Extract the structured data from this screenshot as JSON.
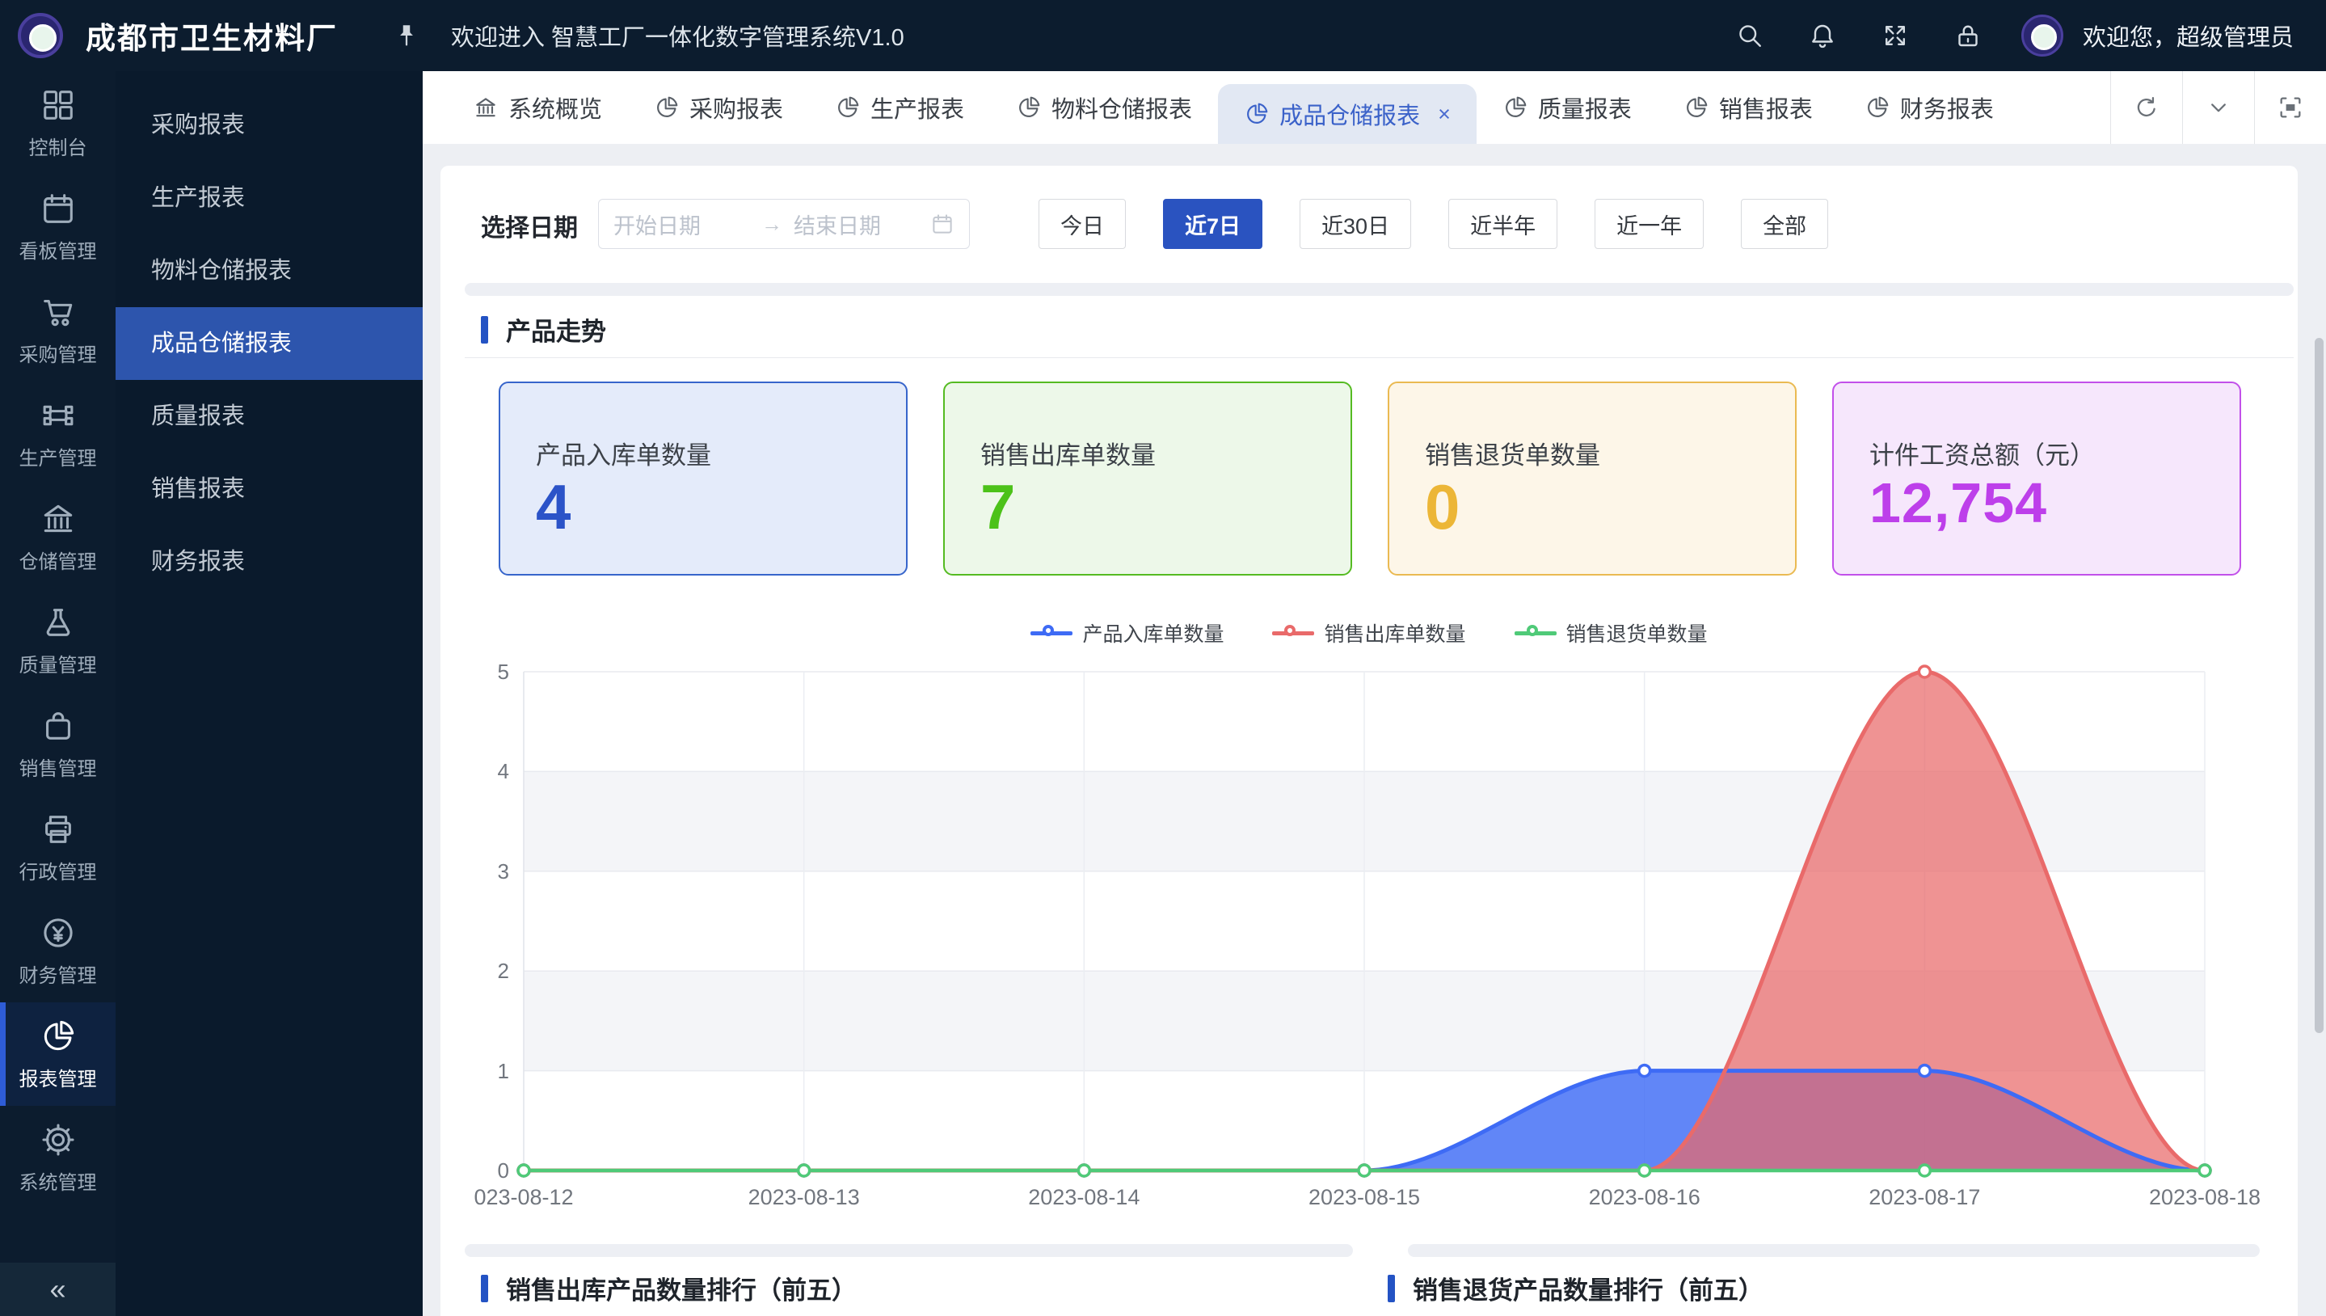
{
  "header": {
    "brand": "成都市卫生材料厂",
    "welcome": "欢迎进入 智慧工厂一体化数字管理系统V1.0",
    "greeting": "欢迎您，超级管理员",
    "icons": [
      "pin-icon",
      "search-icon",
      "bell-icon",
      "fullscreen-expand-icon",
      "lock-icon"
    ]
  },
  "rail": {
    "items": [
      {
        "label": "控制台",
        "icon": "dashboard-grid-icon",
        "active": false
      },
      {
        "label": "看板管理",
        "icon": "board-calendar-icon",
        "active": false
      },
      {
        "label": "采购管理",
        "icon": "cart-icon",
        "active": false
      },
      {
        "label": "生产管理",
        "icon": "production-nodes-icon",
        "active": false
      },
      {
        "label": "仓储管理",
        "icon": "warehouse-bank-icon",
        "active": false
      },
      {
        "label": "质量管理",
        "icon": "quality-flask-icon",
        "active": false
      },
      {
        "label": "销售管理",
        "icon": "sales-bag-icon",
        "active": false
      },
      {
        "label": "行政管理",
        "icon": "admin-printer-icon",
        "active": false
      },
      {
        "label": "财务管理",
        "icon": "finance-exchange-icon",
        "active": false
      },
      {
        "label": "报表管理",
        "icon": "report-pie-icon",
        "active": true
      },
      {
        "label": "系统管理",
        "icon": "system-gear-icon",
        "active": false
      }
    ],
    "collapse_glyph": "«"
  },
  "submenu": {
    "items": [
      {
        "label": "采购报表",
        "active": false
      },
      {
        "label": "生产报表",
        "active": false
      },
      {
        "label": "物料仓储报表",
        "active": false
      },
      {
        "label": "成品仓储报表",
        "active": true
      },
      {
        "label": "质量报表",
        "active": false
      },
      {
        "label": "销售报表",
        "active": false
      },
      {
        "label": "财务报表",
        "active": false
      }
    ]
  },
  "tabs": {
    "items": [
      {
        "label": "系统概览",
        "icon": "bank-icon",
        "active": false,
        "closable": false
      },
      {
        "label": "采购报表",
        "icon": "pie-icon",
        "active": false,
        "closable": false
      },
      {
        "label": "生产报表",
        "icon": "pie-icon",
        "active": false,
        "closable": false
      },
      {
        "label": "物料仓储报表",
        "icon": "pie-icon",
        "active": false,
        "closable": false
      },
      {
        "label": "成品仓储报表",
        "icon": "pie-icon",
        "active": true,
        "closable": true
      },
      {
        "label": "质量报表",
        "icon": "pie-icon",
        "active": false,
        "closable": false
      },
      {
        "label": "销售报表",
        "icon": "pie-icon",
        "active": false,
        "closable": false
      },
      {
        "label": "财务报表",
        "icon": "pie-icon",
        "active": false,
        "closable": false
      }
    ],
    "close_glyph": "×",
    "tools": [
      "refresh-icon",
      "chevron-down-icon",
      "maximize-icon"
    ]
  },
  "filters": {
    "label": "选择日期",
    "start_placeholder": "开始日期",
    "separator": "→",
    "end_placeholder": "结束日期",
    "calendar_icon": "calendar-icon",
    "ranges": [
      {
        "label": "今日",
        "active": false
      },
      {
        "label": "近7日",
        "active": true
      },
      {
        "label": "近30日",
        "active": false
      },
      {
        "label": "近半年",
        "active": false
      },
      {
        "label": "近一年",
        "active": false
      },
      {
        "label": "全部",
        "active": false
      }
    ]
  },
  "sections": {
    "trend_title": "产品走势",
    "rank_out_title": "销售出库产品数量排行（前五）",
    "rank_return_title": "销售退货产品数量排行（前五）"
  },
  "stat_cards": [
    {
      "label": "产品入库单数量",
      "value": "4",
      "bg": "#e4ebfa",
      "border": "#3765cb",
      "color": "#2b53c8"
    },
    {
      "label": "销售出库单数量",
      "value": "7",
      "bg": "#edf8e9",
      "border": "#55bb22",
      "color": "#4cc219"
    },
    {
      "label": "销售退货单数量",
      "value": "0",
      "bg": "#fdf6e8",
      "border": "#eaba52",
      "color": "#ecb637"
    },
    {
      "label": "计件工资总额（元）",
      "value": "12,754",
      "bg": "#f6e7fc",
      "border": "#c250ea",
      "color": "#bd3fea"
    }
  ],
  "chart_data": {
    "type": "line",
    "title": "产品走势",
    "categories": [
      "023-08-12",
      "2023-08-13",
      "2023-08-14",
      "2023-08-15",
      "2023-08-16",
      "2023-08-17",
      "2023-08-18"
    ],
    "series": [
      {
        "name": "产品入库单数量",
        "color": "#3e6bf5",
        "fill": "rgba(62,107,245,0.82)",
        "values": [
          0,
          0,
          0,
          0,
          1,
          1,
          0
        ]
      },
      {
        "name": "销售出库单数量",
        "color": "#e96a6a",
        "fill": "rgba(233,106,106,0.72)",
        "values": [
          0,
          0,
          0,
          0,
          0,
          5,
          0
        ]
      },
      {
        "name": "销售退货单数量",
        "color": "#4fca78",
        "fill": "none",
        "values": [
          0,
          0,
          0,
          0,
          0,
          0,
          0
        ]
      }
    ],
    "ylim": [
      0,
      5
    ],
    "yticks": [
      "0",
      "1",
      "2",
      "3",
      "4",
      "5"
    ],
    "grid": true,
    "legend_position": "top-center",
    "smooth": true
  }
}
